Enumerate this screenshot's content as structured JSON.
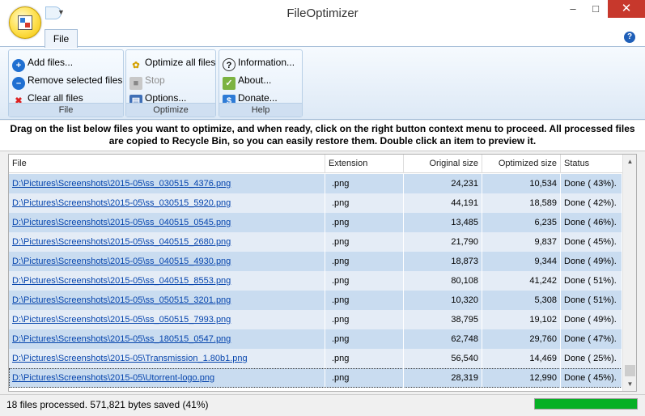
{
  "window": {
    "title": "FileOptimizer",
    "min_glyph": "–",
    "max_glyph": "□",
    "close_glyph": "✕"
  },
  "ribbon": {
    "tab_file": "File",
    "help_glyph": "?",
    "groups": [
      {
        "name": "File",
        "items": [
          {
            "label": "Add files...",
            "icon": "add-icon",
            "glyph": "+"
          },
          {
            "label": "Remove selected files",
            "icon": "remove-icon",
            "glyph": "–"
          },
          {
            "label": "Clear all files",
            "icon": "clear-icon",
            "glyph": "✖"
          }
        ]
      },
      {
        "name": "Optimize",
        "items": [
          {
            "label": "Optimize all files",
            "icon": "optimize-icon",
            "glyph": "✿"
          },
          {
            "label": "Stop",
            "icon": "stop-icon",
            "glyph": "■",
            "disabled": true
          },
          {
            "label": "Options...",
            "icon": "options-icon",
            "glyph": "▤"
          }
        ]
      },
      {
        "name": "Help",
        "items": [
          {
            "label": "Information...",
            "icon": "information-icon",
            "glyph": "?"
          },
          {
            "label": "About...",
            "icon": "about-icon",
            "glyph": "✓"
          },
          {
            "label": "Donate...",
            "icon": "donate-icon",
            "glyph": "$"
          }
        ]
      }
    ]
  },
  "instruction": {
    "line1": "Drag on the list below files you want to optimize, and when ready, click on the right button context menu to proceed. All processed files",
    "line2": "are copied to Recycle Bin, so you can easily restore them. Double click an item to preview it."
  },
  "table": {
    "columns": [
      "File",
      "Extension",
      "Original size",
      "Optimized size",
      "Status"
    ],
    "rows": [
      [
        "D:\\Pictures\\Screenshots\\2015-05\\ss_030515_4376.png",
        ".png",
        "24,231",
        "10,534",
        "Done ( 43%)."
      ],
      [
        "D:\\Pictures\\Screenshots\\2015-05\\ss_030515_5920.png",
        ".png",
        "44,191",
        "18,589",
        "Done ( 42%)."
      ],
      [
        "D:\\Pictures\\Screenshots\\2015-05\\ss_040515_0545.png",
        ".png",
        "13,485",
        "6,235",
        "Done ( 46%)."
      ],
      [
        "D:\\Pictures\\Screenshots\\2015-05\\ss_040515_2680.png",
        ".png",
        "21,790",
        "9,837",
        "Done ( 45%)."
      ],
      [
        "D:\\Pictures\\Screenshots\\2015-05\\ss_040515_4930.png",
        ".png",
        "18,873",
        "9,344",
        "Done ( 49%)."
      ],
      [
        "D:\\Pictures\\Screenshots\\2015-05\\ss_040515_8553.png",
        ".png",
        "80,108",
        "41,242",
        "Done ( 51%)."
      ],
      [
        "D:\\Pictures\\Screenshots\\2015-05\\ss_050515_3201.png",
        ".png",
        "10,320",
        "5,308",
        "Done ( 51%)."
      ],
      [
        "D:\\Pictures\\Screenshots\\2015-05\\ss_050515_7993.png",
        ".png",
        "38,795",
        "19,102",
        "Done ( 49%)."
      ],
      [
        "D:\\Pictures\\Screenshots\\2015-05\\ss_180515_0547.png",
        ".png",
        "62,748",
        "29,760",
        "Done ( 47%)."
      ],
      [
        "D:\\Pictures\\Screenshots\\2015-05\\Transmission_1.80b1.png",
        ".png",
        "56,540",
        "14,469",
        "Done ( 25%)."
      ],
      [
        "D:\\Pictures\\Screenshots\\2015-05\\Utorrent-logo.png",
        ".png",
        "28,319",
        "12,990",
        "Done ( 45%)."
      ]
    ],
    "selected_row": 10
  },
  "scrollbar": {
    "up_glyph": "▲",
    "down_glyph": "▼"
  },
  "status": {
    "text": "18 files processed. 571,821 bytes saved (41%)",
    "progress": 1.0
  },
  "colors": {
    "progress": "#06b025",
    "close": "#c7382c",
    "row_even": "#e4ecf6",
    "row_odd": "#c9dcf0",
    "link": "#0645ad"
  }
}
